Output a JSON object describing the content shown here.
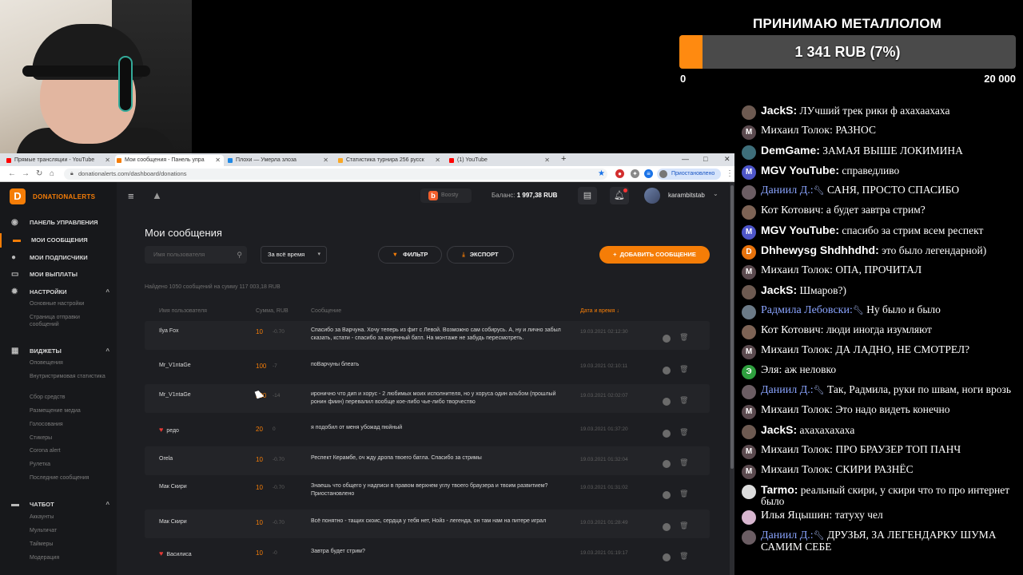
{
  "goal": {
    "title": "ПРИНИМАЮ МЕТАЛЛОЛОМ",
    "amount_text": "1 341 RUB (7%)",
    "progress_fraction": 0.07,
    "min_label": "0",
    "max_label": "20 000",
    "color": "#ff8a10"
  },
  "chat": [
    {
      "nick": "JackS:",
      "text": "ЛУчший трек рики ф ахахаахаха",
      "avatar": "",
      "avatar_color": "#6d5a51",
      "nick_color": "#ffffff",
      "bold": true
    },
    {
      "nick": "Михаил Толок:",
      "text": "РАЗНОС",
      "avatar": "M",
      "avatar_color": "#5b4a4f",
      "nick_color": "#ffffff",
      "bold": false
    },
    {
      "nick": "DemGame:",
      "text": "ЗАМАЯ ВЫШЕ ЛОКИМИНА",
      "avatar": "",
      "avatar_color": "#3e6e7a",
      "nick_color": "#ffffff",
      "bold": true
    },
    {
      "nick": "MGV YouTube:",
      "text": "справедливо",
      "avatar": "M",
      "avatar_color": "#4e56c9",
      "nick_color": "#ffffff",
      "bold": true
    },
    {
      "nick": "Даниил Д.:",
      "text": "САНЯ, ПРОСТО СПАСИБО",
      "avatar": "",
      "avatar_color": "#6b5d63",
      "nick_color": "#8aa4ff",
      "bold": false,
      "mod": true
    },
    {
      "nick": "Кот Котович:",
      "text": "а будет завтра стрим?",
      "avatar": "",
      "avatar_color": "#7d6355",
      "nick_color": "#ffffff",
      "bold": false
    },
    {
      "nick": "MGV YouTube:",
      "text": "спасибо за стрим всем респект",
      "avatar": "M",
      "avatar_color": "#4e56c9",
      "nick_color": "#ffffff",
      "bold": true
    },
    {
      "nick": "Dhhewysg Shdhhdhd:",
      "text": "это было легендарной)",
      "avatar": "D",
      "avatar_color": "#e8730c",
      "nick_color": "#ffffff",
      "bold": true
    },
    {
      "nick": "Михаил Толок:",
      "text": "ОПА, ПРОЧИТАЛ",
      "avatar": "M",
      "avatar_color": "#5b4a4f",
      "nick_color": "#ffffff",
      "bold": false
    },
    {
      "nick": "JackS:",
      "text": "Шмаров?)",
      "avatar": "",
      "avatar_color": "#6d5a51",
      "nick_color": "#ffffff",
      "bold": true
    },
    {
      "nick": "Радмила Лебовски:",
      "text": "Ну было и было",
      "avatar": "",
      "avatar_color": "#6b7a87",
      "nick_color": "#8aa4ff",
      "bold": false,
      "mod": true
    },
    {
      "nick": "Кот Котович:",
      "text": "люди иногда изумляют",
      "avatar": "",
      "avatar_color": "#7d6355",
      "nick_color": "#ffffff",
      "bold": false
    },
    {
      "nick": "Михаил Толок:",
      "text": "ДА ЛАДНО, НЕ СМОТРЕЛ?",
      "avatar": "M",
      "avatar_color": "#5b4a4f",
      "nick_color": "#ffffff",
      "bold": false
    },
    {
      "nick": "Эля:",
      "text": "аж неловко",
      "avatar": "Э",
      "avatar_color": "#2e9f3e",
      "nick_color": "#ffffff",
      "bold": false
    },
    {
      "nick": "Даниил Д.:",
      "text": "Так, Радмила, руки по швам, ноги врозь",
      "avatar": "",
      "avatar_color": "#6b5d63",
      "nick_color": "#8aa4ff",
      "bold": false,
      "mod": true
    },
    {
      "nick": "Михаил Толок:",
      "text": "Это надо видеть конечно",
      "avatar": "M",
      "avatar_color": "#5b4a4f",
      "nick_color": "#ffffff",
      "bold": false
    },
    {
      "nick": "JackS:",
      "text": "ахахахахаха",
      "avatar": "",
      "avatar_color": "#6d5a51",
      "nick_color": "#ffffff",
      "bold": true
    },
    {
      "nick": "Михаил Толок:",
      "text": "ПРО БРАУЗЕР ТОП ПАНЧ",
      "avatar": "M",
      "avatar_color": "#5b4a4f",
      "nick_color": "#ffffff",
      "bold": false
    },
    {
      "nick": "Михаил Толок:",
      "text": "СКИРИ РАЗНЁС",
      "avatar": "M",
      "avatar_color": "#5b4a4f",
      "nick_color": "#ffffff",
      "bold": false
    },
    {
      "nick": "Tarmo:",
      "text": "реальный скири, у скири что то про интернет было",
      "avatar": "",
      "avatar_color": "#dcdcdc",
      "nick_color": "#ffffff",
      "bold": true
    },
    {
      "nick": "Илья Яцышин:",
      "text": "татуху чел",
      "avatar": "",
      "avatar_color": "#d7b6cf",
      "nick_color": "#ffffff",
      "bold": false
    },
    {
      "nick": "Даниил Д.:",
      "text": "ДРУЗЬЯ, ЗА ЛЕГЕНДАРКУ ШУМА САМИМ СЕБЕ",
      "avatar": "",
      "avatar_color": "#6b5d63",
      "nick_color": "#8aa4ff",
      "bold": false,
      "mod": true
    }
  ],
  "browser": {
    "tabs": [
      {
        "label": "Прямые трансляции - YouTube",
        "favicon_color": "#ff0000"
      },
      {
        "label": "Мои сообщения - Панель упра",
        "favicon_color": "#f57d07"
      },
      {
        "label": "Плохи — Умерла злоза",
        "favicon_color": "#1e88e5"
      },
      {
        "label": "Статистика турнира 256 русск",
        "favicon_color": "#f9a825"
      },
      {
        "label": "(1) YouTube",
        "favicon_color": "#ff0000"
      }
    ],
    "new_tab": "+",
    "url": "donationalerts.com/dashboard/donations",
    "paused_label": "Приостановлено",
    "window_controls": [
      "—",
      "□",
      "✕"
    ]
  },
  "app": {
    "logo_mark": "D",
    "logo_name": "DONATIONALERTS",
    "sidebar": {
      "items": [
        {
          "label": "ПАНЕЛЬ УПРАВЛЕНИЯ",
          "icon": "dashboard-icon",
          "glyph": "◉"
        },
        {
          "label": "МОИ СООБЩЕНИЯ",
          "icon": "message-icon",
          "glyph": "▬",
          "active": true
        },
        {
          "label": "МОИ ПОДПИСЧИКИ",
          "icon": "user-icon",
          "glyph": "●"
        },
        {
          "label": "МОИ ВЫПЛАТЫ",
          "icon": "wallet-icon",
          "glyph": "▭"
        }
      ],
      "settings": {
        "label": "НАСТРОЙКИ",
        "icon": "gear-icon",
        "glyph": "✹",
        "chevron": "^"
      },
      "settings_sub": [
        "Основные настройки",
        "Страница отправки сообщений"
      ],
      "widgets": {
        "label": "ВИДЖЕТЫ",
        "icon": "widgets-icon",
        "glyph": "▦",
        "chevron": "^"
      },
      "widgets_sub": [
        "Оповещения",
        "Внутристримовая статистика",
        "Сбор средств",
        "Размещение медиа",
        "Голосования",
        "Стикеры",
        "Corona alert",
        "Рулетка",
        "Последние сообщения"
      ],
      "chatbot": {
        "label": "ЧАТБОТ",
        "icon": "chatbot-icon",
        "glyph": "▬",
        "chevron": "^"
      },
      "chatbot_sub": [
        "Аккаунты",
        "Мультичат",
        "Таймеры",
        "Модерация"
      ]
    },
    "topbar": {
      "boosty_label": "Boosty",
      "balance_label": "Баланс:",
      "balance_value": "1 997,38 RUB",
      "username": "karambitstab"
    },
    "page_title": "Мои сообщения",
    "search_placeholder": "Имя пользователя",
    "period_value": "За всё время",
    "filter_label": "ФИЛЬТР",
    "export_label": "ЭКСПОРТ",
    "add_label": "ДОБАВИТЬ СООБЩЕНИЕ",
    "found_text": "Найдено 1050 сообщений на сумму 117 003,18 RUB",
    "columns": {
      "user": "Имя пользователя",
      "amount": "Сумма, RUB",
      "message": "Сообщение",
      "date": "Дата и время ↓"
    },
    "rows": [
      {
        "user": "Ilya Fox",
        "heart": false,
        "amount": "10",
        "sub": "-0.70",
        "message": "Спасибо за Варчуна. Хочу теперь из фит с Левой. Возможно сам собирусь. А, ну и лично забыл сказать, кстати - спасибо за ахуенный батл. На монтаже не забудь пересмотреть.",
        "date": "19.03.2021 02:12:30"
      },
      {
        "user": "Mr_V1ntaGe",
        "heart": false,
        "amount": "100",
        "sub": "-7",
        "message": "поВарчуны блеать",
        "date": "19.03.2021 02:10:11"
      },
      {
        "user": "Mr_V1ntaGe",
        "heart": false,
        "amount": "200",
        "sub": "-14",
        "message": "иронично что дип и хорус - 2 любимых моих исполнителя, но у хоруса один альбом (прошлый ронин фиин) перевалил вообще кое-либо чье-либо творчество",
        "date": "19.03.2021 02:02:07"
      },
      {
        "user": "редо",
        "heart": true,
        "amount": "20",
        "sub": "0",
        "message": "я подобил от меня убожад пюйный",
        "date": "19.03.2021 01:37:20"
      },
      {
        "user": "Orela",
        "heart": false,
        "amount": "10",
        "sub": "-0.70",
        "message": "Респект Керамбе, оч жду дропа твоего батла. Спасибо за стримы",
        "date": "19.03.2021 01:32:04"
      },
      {
        "user": "Мак Скири",
        "heart": false,
        "amount": "10",
        "sub": "-0.70",
        "message": "Знаешь что общего у надписи в правом верхнем углу твоего браузера и твоим развитием? Приостановлено",
        "date": "19.03.2021 01:31:02"
      },
      {
        "user": "Мак Скири",
        "heart": false,
        "amount": "10",
        "sub": "-0.70",
        "message": "Всё понятно - тащих скоис, сердца у тебя нет, Нойз - легенда, он там нам на питере играл",
        "date": "19.03.2021 01:28:49"
      },
      {
        "user": "Василиса",
        "heart": true,
        "amount": "10",
        "sub": "-0",
        "message": "Завтра будет стрим?",
        "date": "19.03.2021 01:19:17"
      }
    ]
  }
}
